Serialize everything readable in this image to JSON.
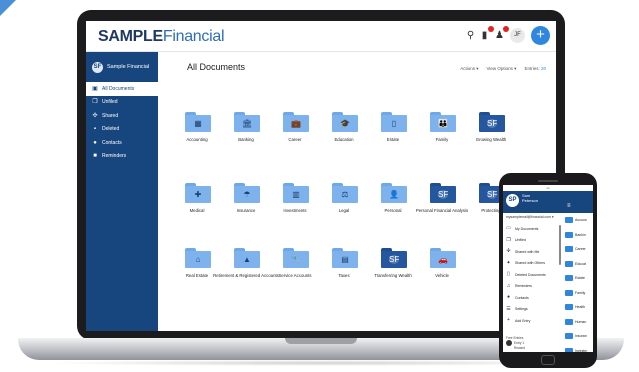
{
  "header": {
    "logo_bold": "SAMPLE",
    "logo_light": "Financial",
    "icons": [
      "search-icon",
      "notification-icon",
      "alert-icon",
      "user-icon"
    ],
    "plus_label": "+",
    "avatar_text": "JF"
  },
  "sidebar": {
    "brand": "Sample Financial",
    "brand_icon": "SF",
    "items": [
      {
        "label": "All Documents",
        "icon": "documents-icon",
        "glyph": "▣"
      },
      {
        "label": "Unfiled",
        "icon": "unfiled-icon",
        "glyph": "❐"
      },
      {
        "label": "Shared",
        "icon": "shared-icon",
        "glyph": "✣"
      },
      {
        "label": "Deleted",
        "icon": "trash-icon",
        "glyph": "▪"
      },
      {
        "label": "Contacts",
        "icon": "contacts-icon",
        "glyph": "●"
      },
      {
        "label": "Reminders",
        "icon": "reminders-icon",
        "glyph": "■"
      }
    ]
  },
  "main": {
    "title": "All Documents",
    "actions": "Actions ▾",
    "view_options": "View Options ▾",
    "entries_label": "Entries:",
    "entries_value": "20",
    "folders": [
      {
        "label": "Accounting",
        "icon": "calculator-icon",
        "glyph": "▦",
        "dark": false
      },
      {
        "label": "Banking",
        "icon": "bank-icon",
        "glyph": "🏛",
        "dark": false
      },
      {
        "label": "Career",
        "icon": "briefcase-icon",
        "glyph": "💼",
        "dark": false
      },
      {
        "label": "Education",
        "icon": "graduation-cap-icon",
        "glyph": "🎓",
        "dark": false
      },
      {
        "label": "Estate",
        "icon": "building-icon",
        "glyph": "▯",
        "dark": false
      },
      {
        "label": "Family",
        "icon": "family-icon",
        "glyph": "👪",
        "dark": false
      },
      {
        "label": "Growing Wealth",
        "icon": "sf-logo-icon",
        "glyph": "SF",
        "dark": true
      },
      {
        "label": "Medical",
        "icon": "medical-icon",
        "glyph": "✚",
        "dark": false
      },
      {
        "label": "Insurance",
        "icon": "umbrella-icon",
        "glyph": "☂",
        "dark": false
      },
      {
        "label": "Investments",
        "icon": "chart-icon",
        "glyph": "▥",
        "dark": false
      },
      {
        "label": "Legal",
        "icon": "gavel-icon",
        "glyph": "⚖",
        "dark": false
      },
      {
        "label": "Personal",
        "icon": "person-icon",
        "glyph": "👤",
        "dark": false
      },
      {
        "label": "Personal Financial Analysis",
        "icon": "sf-logo-icon",
        "glyph": "SF",
        "dark": true
      },
      {
        "label": "Protecting",
        "icon": "sf-logo-icon",
        "glyph": "SF",
        "dark": true
      },
      {
        "label": "Real Estate",
        "icon": "house-icon",
        "glyph": "⌂",
        "dark": false
      },
      {
        "label": "Retirement & Registered Accounts",
        "icon": "mountain-chart-icon",
        "glyph": "▲",
        "dark": false
      },
      {
        "label": "Service Accounts",
        "icon": "wrench-icon",
        "glyph": "🔧",
        "dark": false
      },
      {
        "label": "Taxes",
        "icon": "box-icon",
        "glyph": "▤",
        "dark": false
      },
      {
        "label": "Transferring Wealth",
        "icon": "sf-logo-icon",
        "glyph": "SF",
        "dark": true
      },
      {
        "label": "Vehicle",
        "icon": "car-icon",
        "glyph": "🚗",
        "dark": false
      }
    ]
  },
  "phone": {
    "avatar": "SP",
    "name_line1": "Sam",
    "name_line2": "Peterson",
    "email": "mysamplemail@financial.com ▾",
    "menu": [
      {
        "label": "My Documents",
        "icon": "documents-icon",
        "glyph": "▭"
      },
      {
        "label": "Unfiled",
        "icon": "unfiled-icon",
        "glyph": "❐"
      },
      {
        "label": "Shared with Me",
        "icon": "shared-icon",
        "glyph": "✣"
      },
      {
        "label": "Shared with Others",
        "icon": "share-others-icon",
        "glyph": "✦"
      },
      {
        "label": "Deleted Documents",
        "icon": "trash-icon",
        "glyph": "▯"
      },
      {
        "label": "Reminders",
        "icon": "bell-icon",
        "glyph": "♫"
      },
      {
        "label": "Contacts",
        "icon": "contacts-icon",
        "glyph": "●"
      },
      {
        "label": "Settings",
        "icon": "settings-icon",
        "glyph": "☰"
      },
      {
        "label": "Add Entry",
        "icon": "add-icon",
        "glyph": "+"
      }
    ],
    "side_items": [
      "Accoun",
      "Bankin",
      "Career",
      "Educat",
      "Estate",
      "Family",
      "Health",
      "Human",
      "Insuran",
      "Investm"
    ],
    "entry_small": "Free Entries",
    "entry_label": "Entry 1",
    "entry_sub": "Reward"
  }
}
